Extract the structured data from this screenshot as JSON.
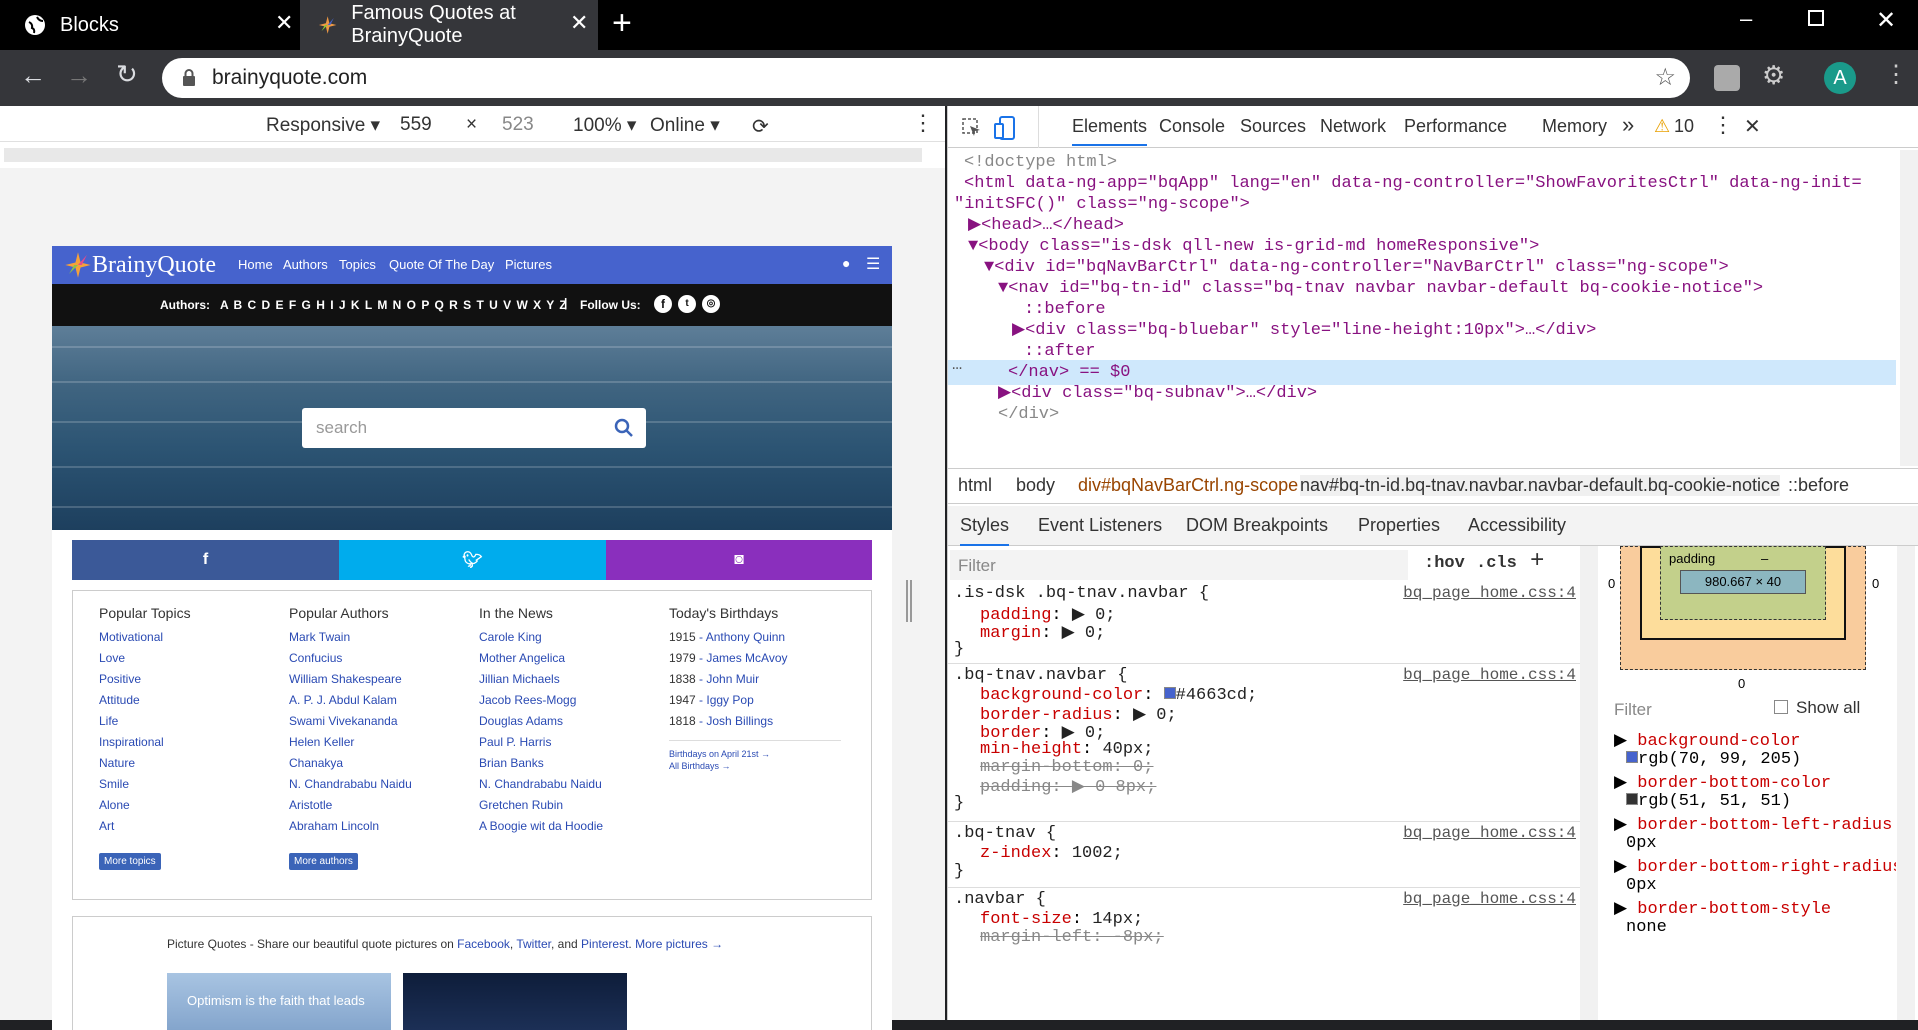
{
  "browser": {
    "tabs": [
      {
        "title": "Blocks"
      },
      {
        "title": "Famous Quotes at BrainyQuote"
      }
    ],
    "url": "brainyquote.com",
    "profile_initial": "A"
  },
  "device_toolbar": {
    "mode": "Responsive",
    "width": "559",
    "height": "523",
    "zoom": "100%",
    "network": "Online",
    "times": "×"
  },
  "bq": {
    "brand": "BrainyQuote",
    "nav": [
      "Home",
      "Authors",
      "Topics",
      "Quote Of The Day",
      "Pictures"
    ],
    "authors_label": "Authors:",
    "letters": "A B C D E F G H I J K L M N O P Q R S T U V W X Y Z",
    "follow_label": "Follow Us:",
    "search_placeholder": "search",
    "columns": [
      {
        "title": "Popular Topics",
        "items": [
          "Motivational",
          "Love",
          "Positive",
          "Attitude",
          "Life",
          "Inspirational",
          "Nature",
          "Smile",
          "Alone",
          "Art"
        ],
        "button": "More topics"
      },
      {
        "title": "Popular Authors",
        "items": [
          "Mark Twain",
          "Confucius",
          "William Shakespeare",
          "A. P. J. Abdul Kalam",
          "Swami Vivekananda",
          "Helen Keller",
          "Chanakya",
          "N. Chandrababu Naidu",
          "Aristotle",
          "Abraham Lincoln"
        ],
        "button": "More authors"
      },
      {
        "title": "In the News",
        "items": [
          "Carole King",
          "Mother Angelica",
          "Jillian Michaels",
          "Jacob Rees-Mogg",
          "Douglas Adams",
          "Paul P. Harris",
          "Brian Banks",
          "N. Chandrababu Naidu",
          "Gretchen Rubin",
          "A Boogie wit da Hoodie"
        ]
      },
      {
        "title": "Today's Birthdays",
        "items": [
          {
            "year": "1915",
            "name": "Anthony Quinn"
          },
          {
            "year": "1979",
            "name": "James McAvoy"
          },
          {
            "year": "1838",
            "name": "John Muir"
          },
          {
            "year": "1947",
            "name": "Iggy Pop"
          },
          {
            "year": "1818",
            "name": "Josh Billings"
          }
        ],
        "links": [
          "Birthdays on April 21st →",
          "All Birthdays →"
        ]
      }
    ],
    "pic_quotes": {
      "title": "Picture Quotes",
      "desc": " - Share our beautiful quote pictures on ",
      "facebook": "Facebook",
      "comma": ", ",
      "twitter": "Twitter",
      "and": ", and ",
      "pinterest": "Pinterest",
      "period": ". ",
      "more": "More pictures →"
    },
    "pic_caption": "Optimism is the faith that leads"
  },
  "devtools": {
    "tabs": [
      "Elements",
      "Console",
      "Sources",
      "Network",
      "Performance",
      "Memory"
    ],
    "more": "»",
    "warnings": "10",
    "dom": [
      {
        "t": "<!doctype html>"
      },
      {
        "t": "<html data-ng-app=\"bqApp\" lang=\"en\" data-ng-controller=\"ShowFavoritesCtrl\" data-ng-init="
      },
      {
        "t": "\"initSFC()\" class=\"ng-scope\">"
      },
      {
        "t": "▶<head>…</head>"
      },
      {
        "t": "▼<body class=\"is-dsk qll-new is-grid-md homeResponsive\">"
      },
      {
        "t": "▼<div id=\"bqNavBarCtrl\" data-ng-controller=\"NavBarCtrl\" class=\"ng-scope\">"
      },
      {
        "t": "▼<nav id=\"bq-tn-id\" class=\"bq-tnav navbar navbar-default bq-cookie-notice\">"
      },
      {
        "t": "::before"
      },
      {
        "t": "▶<div class=\"bq-bluebar\" style=\"line-height:10px\">…</div>"
      },
      {
        "t": "::after"
      },
      {
        "t": "</nav> == $0"
      },
      {
        "t": "▶<div class=\"bq-subnav\">…</div>"
      },
      {
        "t": "</div>"
      }
    ],
    "crumbs": [
      "html",
      "body",
      "div#bqNavBarCtrl.ng-scope",
      "nav#bq-tn-id.bq-tnav.navbar.navbar-default.bq-cookie-notice",
      "::before"
    ],
    "subtabs": [
      "Styles",
      "Event Listeners",
      "DOM Breakpoints",
      "Properties",
      "Accessibility"
    ],
    "filter_placeholder": "Filter",
    "hov": ":hov",
    "cls": ".cls",
    "rules": [
      {
        "selector": ".is-dsk .bq-tnav.navbar {",
        "source": "bq_page_home.css:4",
        "decls": [
          [
            "padding",
            "▶ 0;"
          ],
          [
            "margin",
            "▶ 0;"
          ]
        ]
      },
      {
        "selector": ".bq-tnav.navbar {",
        "source": "bq_page_home.css:4",
        "decls": [
          [
            "background-color",
            "#4663cd;"
          ],
          [
            "border-radius",
            "▶ 0;"
          ],
          [
            "border",
            "▶ 0;"
          ],
          [
            "min-height",
            "40px;"
          ],
          [
            "margin-bottom",
            "0;"
          ],
          [
            "padding",
            "▶ 0 8px;"
          ]
        ]
      },
      {
        "selector": ".bq-tnav {",
        "source": "bq_page_home.css:4",
        "decls": [
          [
            "z-index",
            "1002;"
          ]
        ]
      },
      {
        "selector": ".navbar {",
        "source": "bq_page_home.css:4",
        "decls": [
          [
            "font-size",
            "14px;"
          ],
          [
            "margin-left",
            "-8px;"
          ]
        ]
      }
    ],
    "box": {
      "label": "padding",
      "dash": "–",
      "size": "980.667 × 40",
      "zero": "0"
    },
    "computed_filter": "Filter",
    "show_all": "Show all",
    "computed": [
      {
        "name": "background-color",
        "value": "rgb(70, 99, 205)",
        "swatch": "#4663cd"
      },
      {
        "name": "border-bottom-color",
        "value": "rgb(51, 51, 51)",
        "swatch": "#333333"
      },
      {
        "name": "border-bottom-left-radius",
        "value": "0px"
      },
      {
        "name": "border-bottom-right-radius",
        "value": "0px"
      },
      {
        "name": "border-bottom-style",
        "value": "none"
      }
    ]
  },
  "colors": {
    "bq_blue": "#4663cd",
    "facebook": "#3b5998",
    "twitter": "#00aced",
    "instagram": "#8a2fbd"
  }
}
